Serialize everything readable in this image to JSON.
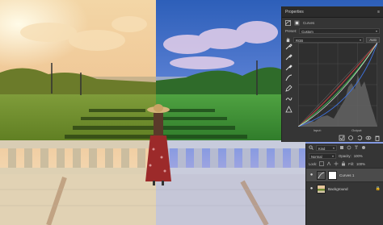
{
  "properties_panel": {
    "title": "Properties",
    "adjustment": "Curves",
    "preset_label": "Preset:",
    "preset_value": "Custom",
    "channel_value": "RGB",
    "auto_label": "Auto",
    "input_label": "Input:",
    "output_label": "Output:"
  },
  "layers_panel": {
    "search_value": "Kind",
    "blend_mode": "Normal",
    "opacity_label": "Opacity:",
    "opacity_value": "100%",
    "lock_label": "Lock:",
    "fill_label": "Fill:",
    "fill_value": "100%",
    "layers": [
      {
        "name": "Curves 1"
      },
      {
        "name": "Background"
      }
    ]
  },
  "colors": {
    "panel_bg": "#353535",
    "curve_red": "#d04040",
    "curve_green": "#3cc050",
    "curve_blue": "#3f73e0",
    "curve_rgb": "#e0e0e0"
  }
}
